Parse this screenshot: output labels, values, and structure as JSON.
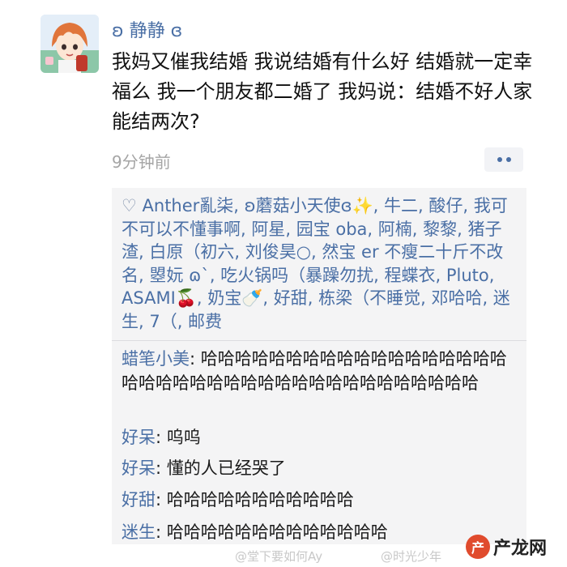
{
  "post": {
    "username": "ʚ 静静 ɞ",
    "text": "我妈又催我结婚 我说结婚有什么好 结婚就一定幸福么 我一个朋友都二婚了 我妈说：结婚不好人家能结两次?",
    "time": "9分钟前"
  },
  "likes": {
    "heart": "♡",
    "names": "Anther亂柒, ʚ蘑菇小天使ɞ✨, 牛二, 酸仔, 我可不可以不懂事啊, 阿星, 园宝 oba, 阿楠, 黎黎, 猪子渣, 白原（初六, 刘俊昊○, 然宝 er 不瘦二十斤不改名, 曌妧 ɷ`, 吃火锅吗（暴躁勿扰, 程蝶衣, Pluto, ASAMI🍒, 奶宝🍼, 好甜, 栋梁（不睡觉, 邓哈哈, 迷生, 7（, 邮费"
  },
  "comments": [
    {
      "author": "蜡笔小美",
      "text": "哈哈哈哈哈哈哈哈哈哈哈哈哈哈哈哈哈哈哈哈哈哈哈哈哈哈哈哈哈哈哈哈哈哈哈哈哈哈哈"
    },
    {
      "author": "好呆",
      "text": "呜呜"
    },
    {
      "author": "好呆",
      "text": "懂的人已经哭了"
    },
    {
      "author": "好甜",
      "text": "哈哈哈哈哈哈哈哈哈哈哈"
    },
    {
      "author": "迷生",
      "text": "哈哈哈哈哈哈哈哈哈哈哈哈哈"
    }
  ],
  "watermarks": {
    "weibo_1": "@堂下要如何Ay",
    "weibo_2": "@时光少年",
    "brand": "产龙网",
    "brand_logo": "产"
  },
  "colors": {
    "link_blue": "#4a6fa5",
    "panel_bg": "#f4f4f5",
    "muted": "#a5a5a5"
  }
}
